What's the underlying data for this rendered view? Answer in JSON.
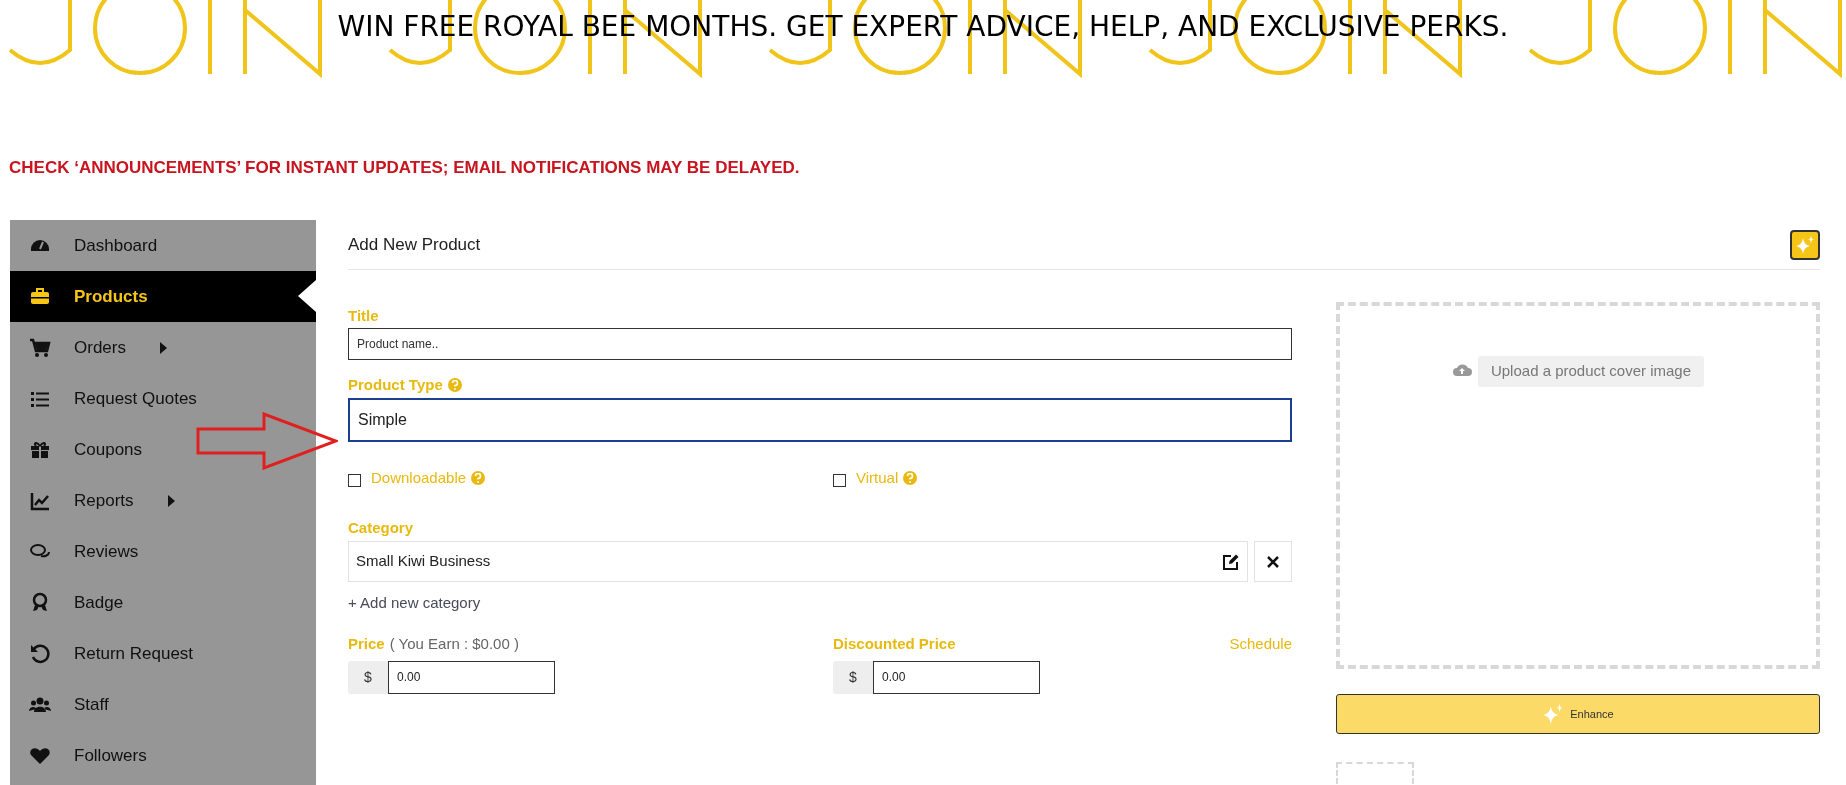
{
  "banner": {
    "subline": "WIN FREE ROYAL BEE MONTHS. GET EXPERT ADVICE, HELP, AND EXCLUSIVE PERKS."
  },
  "notice": "CHECK ‘ANNOUNCEMENTS’ FOR INSTANT UPDATES; EMAIL NOTIFICATIONS MAY BE DELAYED.",
  "sidebar": {
    "items": [
      {
        "label": "Dashboard",
        "selected": false,
        "submenu": false
      },
      {
        "label": "Products",
        "selected": true,
        "submenu": false
      },
      {
        "label": "Orders",
        "selected": false,
        "submenu": true
      },
      {
        "label": "Request Quotes",
        "selected": false,
        "submenu": false
      },
      {
        "label": "Coupons",
        "selected": false,
        "submenu": false
      },
      {
        "label": "Reports",
        "selected": false,
        "submenu": true
      },
      {
        "label": "Reviews",
        "selected": false,
        "submenu": false
      },
      {
        "label": "Badge",
        "selected": false,
        "submenu": false
      },
      {
        "label": "Return Request",
        "selected": false,
        "submenu": false
      },
      {
        "label": "Staff",
        "selected": false,
        "submenu": false
      },
      {
        "label": "Followers",
        "selected": false,
        "submenu": false
      }
    ]
  },
  "form": {
    "heading": "Add New Product",
    "title": {
      "label": "Title",
      "placeholder": "Product name.."
    },
    "product_type": {
      "label": "Product Type",
      "value": "Simple"
    },
    "options": [
      {
        "label": "Downloadable",
        "checked": false
      },
      {
        "label": "Virtual",
        "checked": false
      }
    ],
    "category": {
      "label": "Category",
      "value": "Small Kiwi Business",
      "add_link": "+ Add new category"
    },
    "price": {
      "label": "Price",
      "note": "( You Earn : $0.00 )",
      "currency": "$",
      "value": "0.00"
    },
    "discounted_price": {
      "label": "Discounted Price",
      "link": "Schedule",
      "currency": "$",
      "value": "0.00"
    }
  },
  "media": {
    "upload_button": "Upload a product cover image",
    "enhance_button": "Enhance"
  }
}
